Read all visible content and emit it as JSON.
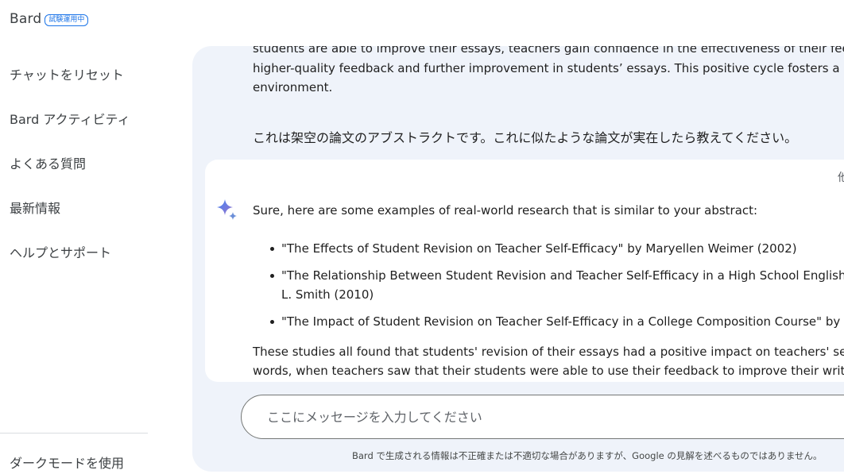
{
  "header": {
    "brand": "Bard",
    "badge": "試験運用中"
  },
  "sidebar": {
    "items": [
      {
        "label": "チャットをリセット"
      },
      {
        "label": "Bard アクティビティ"
      },
      {
        "label": "よくある質問"
      },
      {
        "label": "最新情報"
      },
      {
        "label": "ヘルプとサポート"
      }
    ],
    "bottom": {
      "label": "ダークモードを使用"
    }
  },
  "prompt": {
    "lines": [
      "students are able to improve their essays, teachers gain confidence in the effectiveness of their feedba",
      "higher-quality feedback and further improvement in students’ essays. This positive cycle fosters a cond",
      "environment."
    ],
    "question": "これは架空の論文のアブストラクトです。これに似たような論文が実在したら教えてください。"
  },
  "response": {
    "edge_glyph": "他",
    "intro": "Sure, here are some examples of real-world research that is similar to your abstract:",
    "items": [
      {
        "line1": "\"The Effects of Student Revision on Teacher Self-Efficacy\" by Maryellen Weimer (2002)",
        "line2": ""
      },
      {
        "line1": "\"The Relationship Between Student Revision and Teacher Self-Efficacy in a High School English Cla",
        "line2": "L. Smith (2010)"
      },
      {
        "line1": "\"The Impact of Student Revision on Teacher Self-Efficacy in a College Composition Course\" by Sar",
        "line2": ""
      }
    ],
    "outro_lines": [
      "These studies all found that students' revision of their essays had a positive impact on teachers' self-e",
      "words, when teachers saw that their students were able to use their feedback to improve their writing,"
    ]
  },
  "input": {
    "placeholder": "ここにメッセージを入力してください",
    "value": ""
  },
  "footer": {
    "disclaimer": "Bard で生成される情報は不正確または不適切な場合がありますが、Google の見解を述べるものではありません。"
  },
  "colors": {
    "panel_bg": "#eff3fa",
    "accent": "#1a73e8",
    "sparkle_start": "#4285f4",
    "sparkle_end": "#9b72cb"
  },
  "icons": {
    "response_icon": "bard-sparkle-icon"
  }
}
